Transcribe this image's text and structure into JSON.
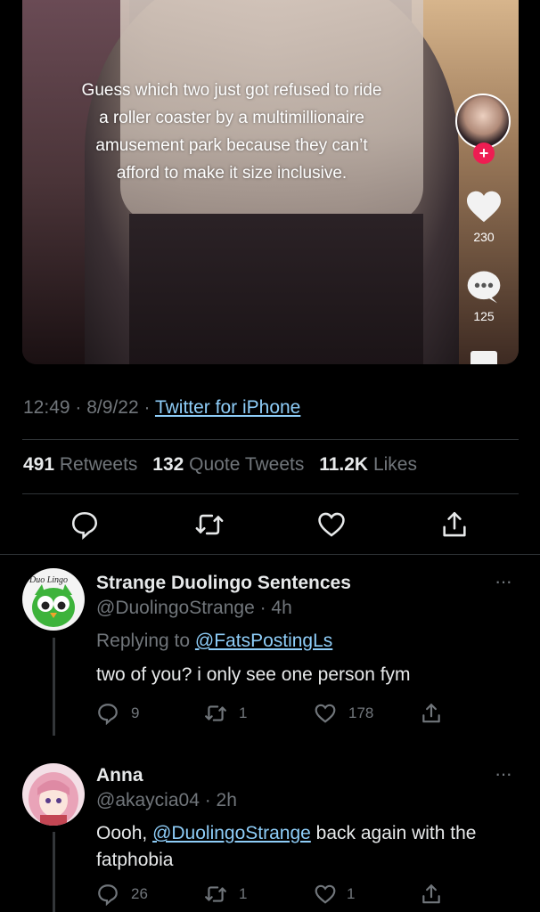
{
  "video": {
    "caption": "Guess which two just got refused to ride a roller coaster by a multimillionaire amusement park because they can’t afford to make it size inclusive.",
    "likes": "230",
    "comments": "125",
    "plus_glyph": "+"
  },
  "meta": {
    "time": "12:49",
    "dot1": "·",
    "date": "8/9/22",
    "dot2": "·",
    "source": "Twitter for iPhone"
  },
  "stats": {
    "retweets_count": "491",
    "retweets_label": "Retweets",
    "quotes_count": "132",
    "quotes_label": "Quote Tweets",
    "likes_count": "11.2K",
    "likes_label": "Likes"
  },
  "colors": {
    "link": "#8ecdf8",
    "muted": "#71767b",
    "text": "#e7e9ea",
    "background": "#000000",
    "tiktok_red": "#ee1d52"
  },
  "replies": [
    {
      "name": "Strange Duolingo Sentences",
      "handle": "@DuolingoStrange · 4h",
      "replying_prefix": "Replying to",
      "replying_to": "@FatsPostingLs",
      "text": "two of you? i only see one person fym",
      "comments": "9",
      "retweets": "1",
      "likes": "178",
      "more": "···",
      "avatar_text": "Duo Lingo"
    },
    {
      "name": "Anna",
      "handle": "@akaycia04 · 2h",
      "text_prefix": "Oooh,",
      "mention": "@DuolingoStrange",
      "text_suffix": "back again with the fatphobia",
      "comments": "26",
      "retweets": "1",
      "likes": "1",
      "more": "···"
    }
  ]
}
